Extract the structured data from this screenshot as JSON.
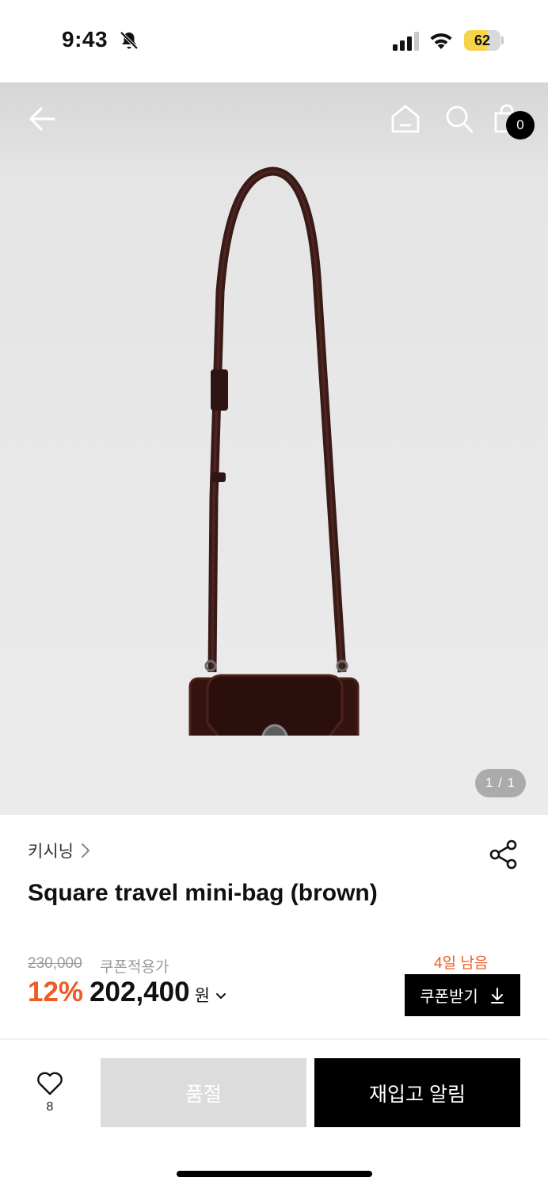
{
  "status_bar": {
    "time": "9:43",
    "battery": "62",
    "battery_level": 0.62,
    "icons": [
      "bell-slash-icon",
      "cellular-signal-icon",
      "wifi-icon",
      "battery-icon"
    ]
  },
  "header": {
    "icons": [
      "back-arrow-icon",
      "home-icon",
      "search-icon",
      "shopping-bag-icon"
    ],
    "cart_count": "0"
  },
  "gallery": {
    "indicator": "1 / 1",
    "image_subject": "bag-image"
  },
  "product": {
    "brand": "키시닝",
    "title": "Square travel mini-bag (brown)",
    "original_price": "230,000",
    "coupon_note": "쿠폰적용가",
    "discount": "12%",
    "price": "202,400",
    "currency": "원",
    "days_left": "4일 남음",
    "coupon_button": "쿠폰받기"
  },
  "bottom_bar": {
    "like_count": "8",
    "soldout_label": "품절",
    "restock_label": "재입고 알림"
  },
  "colors": {
    "accent": "#f05a22",
    "black": "#000000",
    "disabled": "#dcdcdc",
    "bag_brown": "#3a1a17"
  }
}
